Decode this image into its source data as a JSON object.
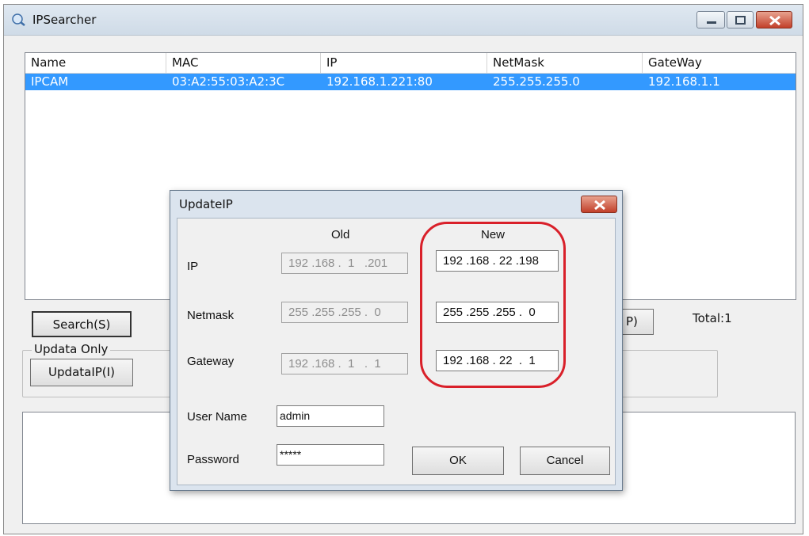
{
  "window": {
    "title": "IPSearcher"
  },
  "list": {
    "columns": [
      "Name",
      "MAC",
      "IP",
      "NetMask",
      "GateWay"
    ],
    "rows": [
      {
        "name": "IPCAM",
        "mac": "03:A2:55:03:A2:3C",
        "ip": "192.168.1.221:80",
        "netmask": "255.255.255.0",
        "gateway": "192.168.1.1"
      }
    ],
    "selection_color": "#3399ff"
  },
  "controls": {
    "search_label": "Search(S)",
    "group_label": "Updata Only",
    "update_ip_label": "UpdataIP(I)",
    "partial_button_label": "P)",
    "total_label": "Total:1"
  },
  "dialog": {
    "title": "UpdateIP",
    "old_header": "Old",
    "new_header": "New",
    "ip_label": "IP",
    "netmask_label": "Netmask",
    "gateway_label": "Gateway",
    "username_label": "User Name",
    "password_label": "Password",
    "old_ip": "192 .168 .  1   .201",
    "old_netmask": "255 .255 .255 .  0",
    "old_gateway": "192 .168 .  1   .  1",
    "new_ip": "192 .168 . 22 .198",
    "new_netmask": "255 .255 .255 .  0",
    "new_gateway": "192 .168 . 22  .  1",
    "username": "admin",
    "password_masked": "*****",
    "ok_label": "OK",
    "cancel_label": "Cancel",
    "highlight_color": "#d9202a"
  }
}
